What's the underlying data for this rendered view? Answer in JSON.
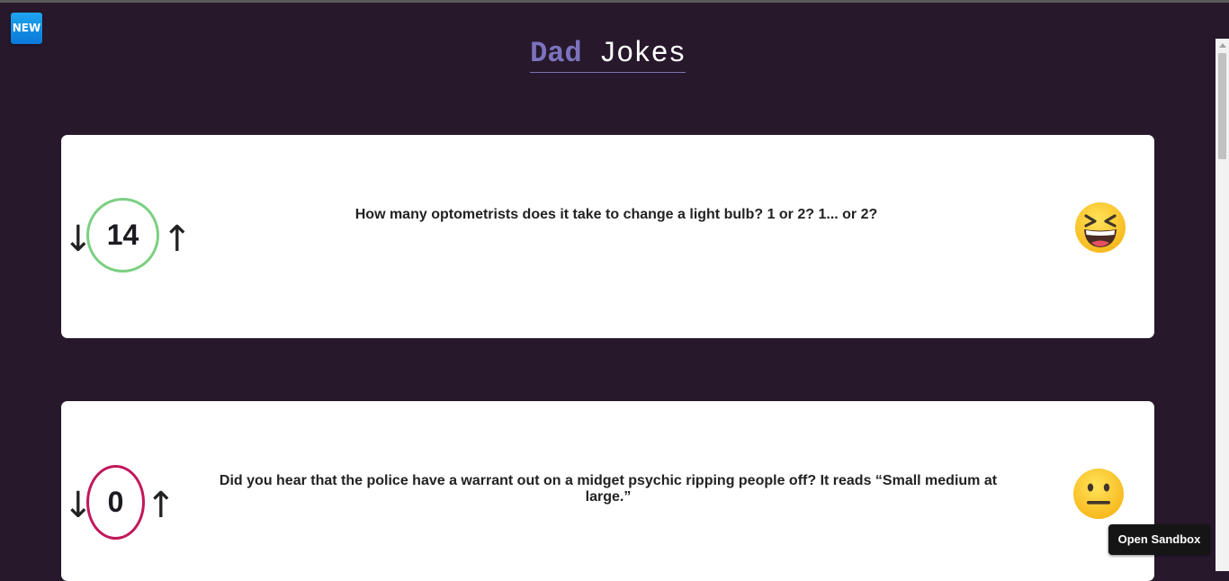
{
  "badge": {
    "label": "NEW"
  },
  "header": {
    "title_part1": "Dad",
    "title_part2": "Jokes"
  },
  "jokes": [
    {
      "votes": "14",
      "text": "How many optometrists does it take to change a light bulb? 1 or 2? 1... or 2?",
      "down_icon": "↓",
      "up_icon": "↑",
      "border_color": "#7bcf82",
      "emoji": "laughing-face-icon"
    },
    {
      "votes": "0",
      "text": "Did you hear that the police have a warrant out on a midget psychic ripping people off? It reads “Small medium at large.”",
      "down_icon": "↓",
      "up_icon": "↑",
      "border_color": "#c2185b",
      "emoji": "neutral-face-icon"
    }
  ],
  "sandbox_button": {
    "label": "Open Sandbox"
  }
}
